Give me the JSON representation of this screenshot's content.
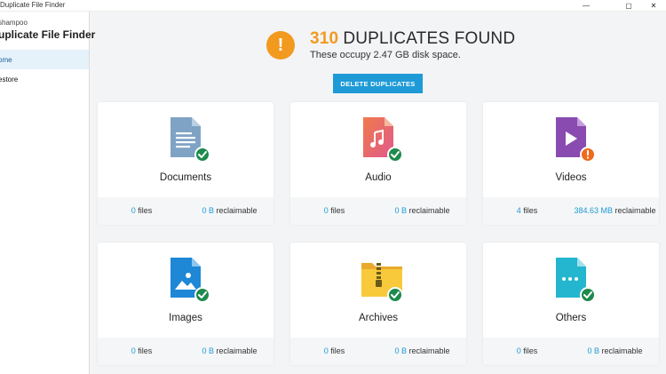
{
  "window": {
    "title": "Duplicate File Finder",
    "controls": {
      "minimize": "—",
      "maximize": "▢",
      "close": "✕"
    }
  },
  "sidebar": {
    "brand_sub": "shampoo",
    "brand_main": "uplicate File Finder",
    "items": [
      {
        "label": "ome",
        "active": true
      },
      {
        "label": "estore",
        "active": false
      }
    ]
  },
  "summary": {
    "count": "310",
    "headline": "DUPLICATES FOUND",
    "subtext": "These occupy 2.47 GB disk space.",
    "warning_glyph": "!",
    "delete_button": "DELETE DUPLICATES"
  },
  "categories": [
    {
      "name": "Documents",
      "files_count": "0",
      "files_label": "files",
      "reclaim_size": "0 B",
      "reclaim_label": "reclaimable",
      "icon": "document-icon",
      "status": "check-badge-icon"
    },
    {
      "name": "Audio",
      "files_count": "0",
      "files_label": "files",
      "reclaim_size": "0 B",
      "reclaim_label": "reclaimable",
      "icon": "audio-file-icon",
      "status": "check-badge-icon"
    },
    {
      "name": "Videos",
      "files_count": "4",
      "files_label": "files",
      "reclaim_size": "384.63 MB",
      "reclaim_label": "reclaimable",
      "icon": "video-file-icon",
      "status": "warning-badge-icon"
    },
    {
      "name": "Images",
      "files_count": "0",
      "files_label": "files",
      "reclaim_size": "0 B",
      "reclaim_label": "reclaimable",
      "icon": "image-file-icon",
      "status": "check-badge-icon"
    },
    {
      "name": "Archives",
      "files_count": "0",
      "files_label": "files",
      "reclaim_size": "0 B",
      "reclaim_label": "reclaimable",
      "icon": "archive-folder-icon",
      "status": "check-badge-icon"
    },
    {
      "name": "Others",
      "files_count": "0",
      "files_label": "files",
      "reclaim_size": "0 B",
      "reclaim_label": "reclaimable",
      "icon": "other-file-icon",
      "status": "check-badge-icon"
    }
  ],
  "colors": {
    "accent": "#1e9bd7",
    "warning": "#f29a1f",
    "success": "#1e8a4c",
    "status_warning": "#f06a1c",
    "sidebar_active": "#e5f2fa"
  }
}
